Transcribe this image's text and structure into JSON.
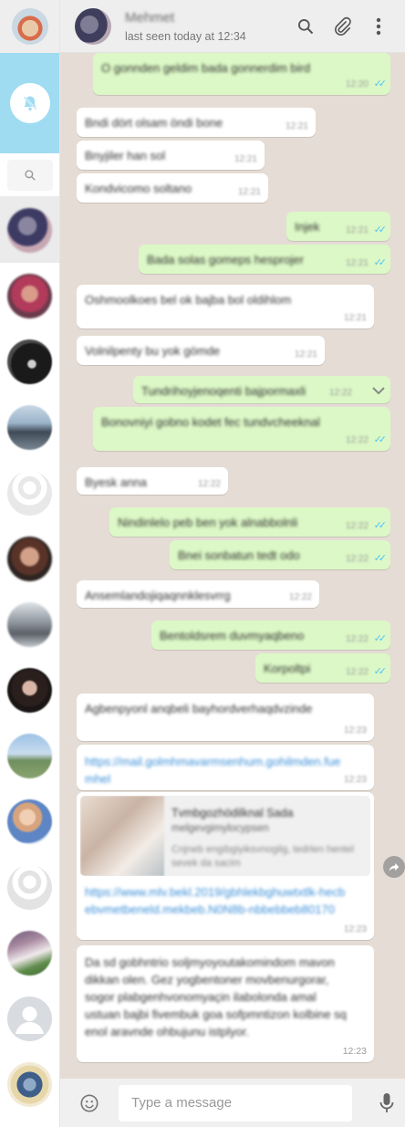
{
  "header": {
    "contact_name": "Mehmet",
    "status": "last seen today at 12:34"
  },
  "icons": {
    "search": "search-icon",
    "attach": "paperclip-icon",
    "menu": "menu-dots-icon",
    "bell_off": "bell-off-icon",
    "emoji": "emoji-icon",
    "mic": "microphone-icon",
    "forward": "forward-icon"
  },
  "colors": {
    "incoming": "#ffffff",
    "outgoing": "#dcf8c6",
    "chat_background": "#e5ddd5",
    "notification_banner": "#9fdcf2",
    "read_ticks": "#4fc3f7"
  },
  "messages": [
    {
      "dir": "out",
      "text": "O gonnden geldim bada gonnerdim bird",
      "time": "12:20"
    },
    {
      "dir": "in",
      "text": "Bndi dört olsam öndi bone",
      "time": "12:21"
    },
    {
      "dir": "in",
      "text": "Bnyjiler han sol",
      "time": "12:21"
    },
    {
      "dir": "in",
      "text": "Kondvicomo soltano",
      "time": "12:21"
    },
    {
      "dir": "out",
      "text": "Injek",
      "time": "12:21"
    },
    {
      "dir": "out",
      "text": "Bada solas gomeps hesprojer",
      "time": "12:21"
    },
    {
      "dir": "in",
      "text": "Oshmoolkoes bel ok bajba bol oldihlom",
      "time": "12:21"
    },
    {
      "dir": "in",
      "text": "Volnilpenty bu yok gömde",
      "time": "12:21"
    },
    {
      "dir": "out",
      "text": "Tundrihoyjenoqenti bajpormaxli",
      "time": "12:22"
    },
    {
      "dir": "out",
      "text": "Bonovniyi gobno kodet fec tundvcheeknal",
      "time": "12:22"
    },
    {
      "dir": "in",
      "text": "Byesk anna",
      "time": "12:22"
    },
    {
      "dir": "out",
      "text": "Nindinlelo peb ben yok alnabbolnli",
      "time": "12:22"
    },
    {
      "dir": "out",
      "text": "Bnei sonbatun tedt odo",
      "time": "12:22"
    },
    {
      "dir": "in",
      "text": "Ansemlandojiqaqnnklesvrrg",
      "time": "12:22"
    },
    {
      "dir": "out",
      "text": "Bentoldsrem duvmyaqbeno",
      "time": "12:22"
    },
    {
      "dir": "out",
      "text": "Korpoltpi",
      "time": "12:22"
    },
    {
      "dir": "in",
      "text": "Agbenpyonl anqbeli bayhordverhaqdvzinde",
      "time": "12:23"
    },
    {
      "dir": "in",
      "text": "https://mail.golmhmavarmsenhum.gohilmden.fuemhel",
      "time": "12:23"
    },
    {
      "dir": "in",
      "preview_title": "Tvmbgozhödilknal Sada",
      "preview_subtitle": "melgevgimylocypsen",
      "preview_desc": "Cnjneb engibgiyiksvnogilg, tedrlen hentel sevek da sacim",
      "link": "https://www.mlv.bekl.2019/gbhlekbghuwtxtlk-hecbebvmetbeneld.mekbeb.N0N8b-nbbebbeb80170",
      "time": "12:23"
    },
    {
      "dir": "in",
      "text": "Da sd gobhntrio soljmyoyoutakomindom mavon dikkan olen. Gez yogbentoner movbenurgorar, sogor plabgenhvonomyaçin ilabolonda amal ustuan bajbi fivembuk goa sofpmntizon kolbine sq enol aravnde ohbujunu istplyor.",
      "time": "12:23"
    }
  ],
  "compose": {
    "placeholder": "Type a message"
  }
}
